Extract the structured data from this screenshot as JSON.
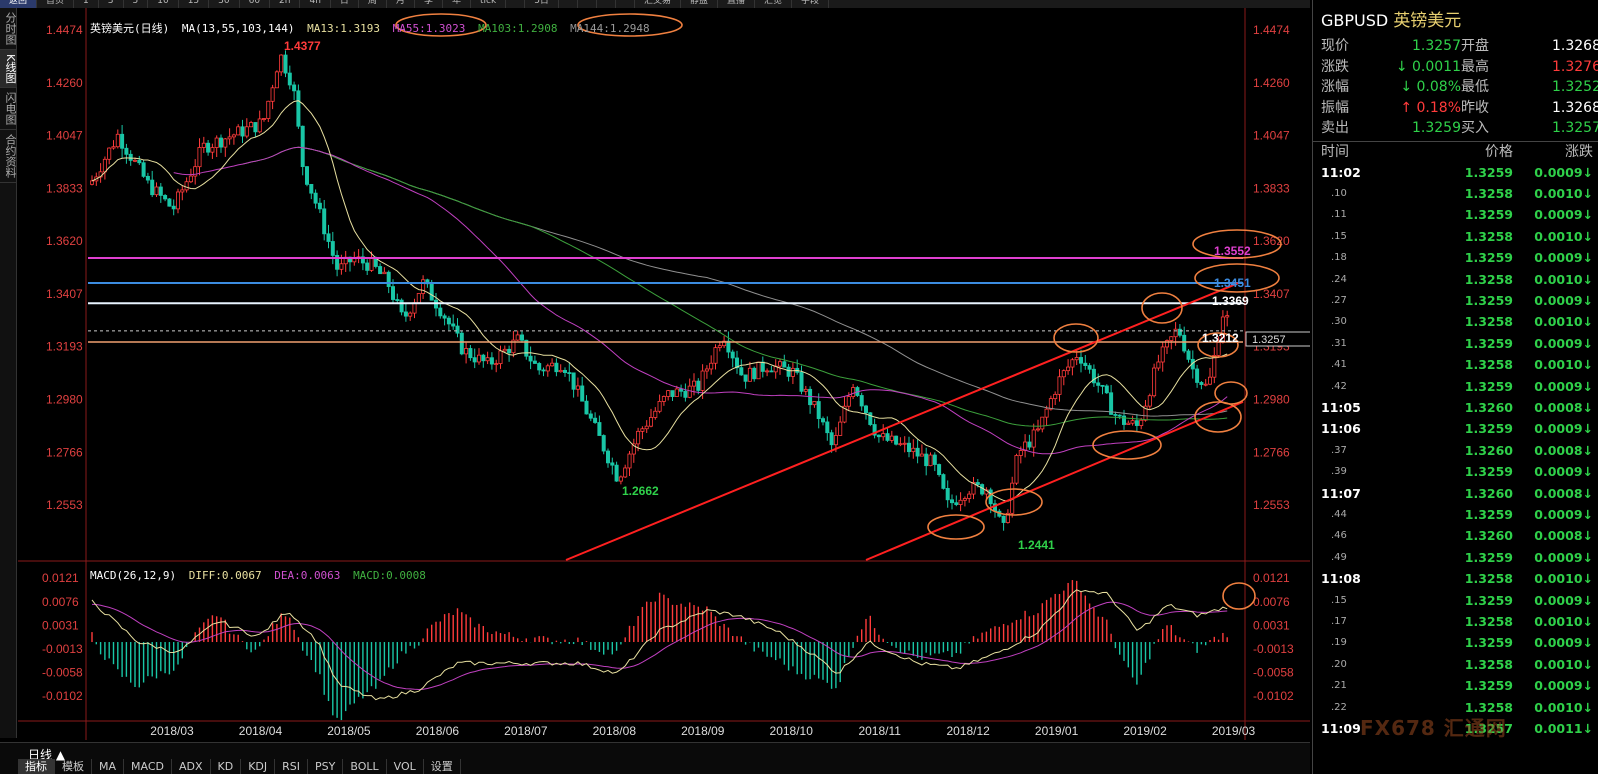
{
  "toolbar": {
    "items": [
      "返回",
      "首页",
      "1",
      "3",
      "5",
      "10",
      "15",
      "30",
      "60",
      "2h",
      "4h",
      "日",
      "周",
      "月",
      "季",
      "年",
      "tick",
      "",
      "5日",
      "",
      "",
      "",
      "",
      "汇交易",
      "静盘",
      "直播",
      "汇览",
      "字段"
    ]
  },
  "left_tabs": [
    "分时图",
    "K线图",
    "闪电图",
    "合约资料"
  ],
  "chart": {
    "title": "英镑美元(日线)",
    "ma_legend": {
      "ma": "MA(13,55,103,144)",
      "ma13": "MA13:1.3193",
      "ma55": "MA55:1.3023",
      "ma103": "MA103:1.2908",
      "ma144": "MA144:1.2948"
    },
    "macd_legend": {
      "name": "MACD(26,12,9)",
      "diff": "DIFF:0.0067",
      "dea": "DEA:0.0063",
      "macd": "MACD:0.0008"
    },
    "colors": {
      "up": "#ff3b3b",
      "down": "#19c6a6",
      "ma13": "#e8e0a0",
      "ma55": "#c040c0",
      "ma103": "#3ca03c",
      "ma144": "#909090",
      "channel": "#ff2020",
      "hline_magenta": "#e040d0",
      "hline_blue": "#3c8ce0",
      "hline_white": "#e8f4ff",
      "hline_orange": "#f0a070",
      "ellipse": "#f08040"
    },
    "price_axis": [
      "1.4474",
      "1.4260",
      "1.4047",
      "1.3833",
      "1.3620",
      "1.3407",
      "1.3193",
      "1.2980",
      "1.2766",
      "1.2553"
    ],
    "macd_axis": [
      "0.0121",
      "0.0076",
      "0.0031",
      "-0.0013",
      "-0.0058",
      "-0.0102"
    ],
    "time_axis": [
      "2018/03",
      "2018/04",
      "2018/05",
      "2018/06",
      "2018/07",
      "2018/08",
      "2018/09",
      "2018/10",
      "2018/11",
      "2018/12",
      "2019/01",
      "2019/02",
      "2019/03"
    ],
    "annotations": {
      "high": "1.4377",
      "low_aug": "1.2662",
      "low_jan": "1.2441",
      "level_1": "1.3552",
      "level_2": "1.3451",
      "level_3": "1.3369",
      "current_tag": "1.3257",
      "orange_level": "1.3212"
    }
  },
  "bottom": {
    "period": "日线 ▲",
    "tabs": [
      "指标",
      "模板",
      "MA",
      "MACD",
      "ADX",
      "KD",
      "KDJ",
      "RSI",
      "PSY",
      "BOLL",
      "VOL",
      "设置"
    ]
  },
  "quote": {
    "symbol": "GBPUSD",
    "name": "英镑美元",
    "rows": [
      {
        "k1": "现价",
        "v1": "1.3257",
        "c1": "green",
        "k2": "开盘",
        "v2": "1.3268",
        "c2": "white"
      },
      {
        "k1": "涨跌",
        "v1": "↓ 0.0011",
        "c1": "green",
        "k2": "最高",
        "v2": "1.3276",
        "c2": "red"
      },
      {
        "k1": "涨幅",
        "v1": "↓ 0.08%",
        "c1": "green",
        "k2": "最低",
        "v2": "1.3252",
        "c2": "green"
      },
      {
        "k1": "振幅",
        "v1": "↑ 0.18%",
        "c1": "red",
        "k2": "昨收",
        "v2": "1.3268",
        "c2": "white"
      },
      {
        "k1": "卖出",
        "v1": "1.3259",
        "c1": "green",
        "k2": "买入",
        "v2": "1.3257",
        "c2": "green"
      }
    ]
  },
  "ticks": {
    "headers": [
      "时间",
      "价格",
      "涨跌"
    ],
    "rows": [
      {
        "t": "11:02",
        "full": true,
        "p": "1.3259",
        "c": "0.0009↓"
      },
      {
        "t": ".10",
        "full": false,
        "p": "1.3258",
        "c": "0.0010↓"
      },
      {
        "t": ".11",
        "full": false,
        "p": "1.3259",
        "c": "0.0009↓"
      },
      {
        "t": ".15",
        "full": false,
        "p": "1.3258",
        "c": "0.0010↓"
      },
      {
        "t": ".18",
        "full": false,
        "p": "1.3259",
        "c": "0.0009↓"
      },
      {
        "t": ".24",
        "full": false,
        "p": "1.3258",
        "c": "0.0010↓"
      },
      {
        "t": ".27",
        "full": false,
        "p": "1.3259",
        "c": "0.0009↓"
      },
      {
        "t": ".30",
        "full": false,
        "p": "1.3258",
        "c": "0.0010↓"
      },
      {
        "t": ".31",
        "full": false,
        "p": "1.3259",
        "c": "0.0009↓"
      },
      {
        "t": ".41",
        "full": false,
        "p": "1.3258",
        "c": "0.0010↓"
      },
      {
        "t": ".42",
        "full": false,
        "p": "1.3259",
        "c": "0.0009↓"
      },
      {
        "t": "11:05",
        "full": true,
        "p": "1.3260",
        "c": "0.0008↓"
      },
      {
        "t": "11:06",
        "full": true,
        "p": "1.3259",
        "c": "0.0009↓"
      },
      {
        "t": ".37",
        "full": false,
        "p": "1.3260",
        "c": "0.0008↓"
      },
      {
        "t": ".39",
        "full": false,
        "p": "1.3259",
        "c": "0.0009↓"
      },
      {
        "t": "11:07",
        "full": true,
        "p": "1.3260",
        "c": "0.0008↓"
      },
      {
        "t": ".44",
        "full": false,
        "p": "1.3259",
        "c": "0.0009↓"
      },
      {
        "t": ".46",
        "full": false,
        "p": "1.3260",
        "c": "0.0008↓"
      },
      {
        "t": ".49",
        "full": false,
        "p": "1.3259",
        "c": "0.0009↓"
      },
      {
        "t": "11:08",
        "full": true,
        "p": "1.3258",
        "c": "0.0010↓"
      },
      {
        "t": ".15",
        "full": false,
        "p": "1.3259",
        "c": "0.0009↓"
      },
      {
        "t": ".17",
        "full": false,
        "p": "1.3258",
        "c": "0.0010↓"
      },
      {
        "t": ".19",
        "full": false,
        "p": "1.3259",
        "c": "0.0009↓"
      },
      {
        "t": ".20",
        "full": false,
        "p": "1.3258",
        "c": "0.0010↓"
      },
      {
        "t": ".21",
        "full": false,
        "p": "1.3259",
        "c": "0.0009↓"
      },
      {
        "t": ".22",
        "full": false,
        "p": "1.3258",
        "c": "0.0010↓"
      },
      {
        "t": "11:09",
        "full": true,
        "p": "1.3257",
        "c": "0.0011↓"
      }
    ]
  },
  "watermark": "FX678 汇通网"
}
